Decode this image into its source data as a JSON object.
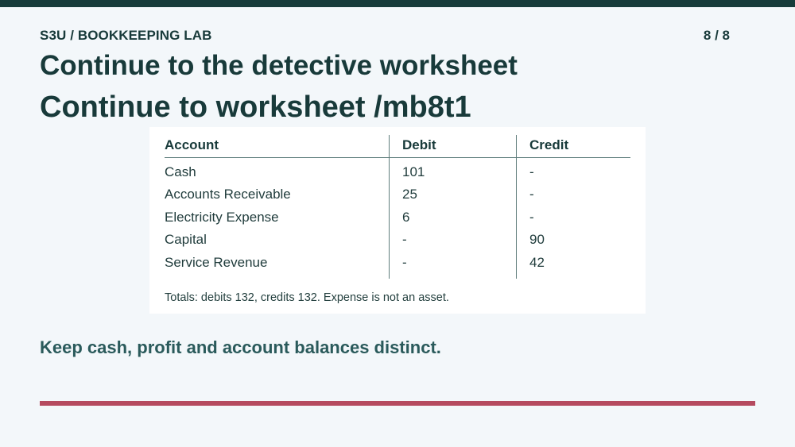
{
  "header": {
    "label": "S3U / BOOKKEEPING LAB",
    "page_counter": "8 / 8"
  },
  "titles": {
    "primary": "Continue to the detective worksheet",
    "secondary": "Continue to worksheet /mb8t1"
  },
  "table": {
    "columns": [
      "Account",
      "Debit",
      "Credit"
    ],
    "rows": [
      {
        "account": "Cash",
        "debit": "101",
        "credit": "-"
      },
      {
        "account": "Accounts Receivable",
        "debit": "25",
        "credit": "-"
      },
      {
        "account": "Electricity Expense",
        "debit": "6",
        "credit": "-"
      },
      {
        "account": "Capital",
        "debit": "-",
        "credit": "90"
      },
      {
        "account": "Service Revenue",
        "debit": "-",
        "credit": "42"
      }
    ],
    "note": "Totals: debits 132, credits 132. Expense is not an asset."
  },
  "takeaway": "Keep cash, profit and account balances distinct.",
  "colors": {
    "top_bar": "#173c3b",
    "background": "#f3f7fa",
    "heading_text": "#183a3a",
    "takeaway_text": "#2a5a5b",
    "accent_rule": "#b54a5f"
  }
}
